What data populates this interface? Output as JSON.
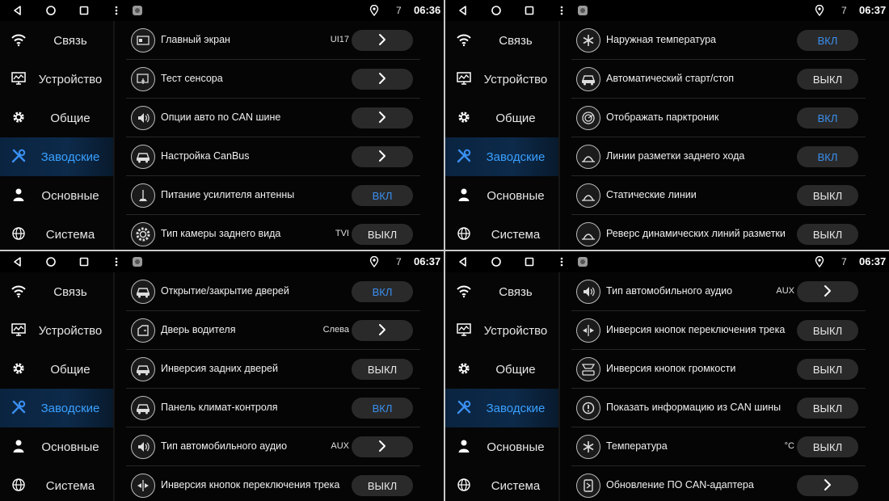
{
  "colors": {
    "accent": "#3a8ff0",
    "active_nav_bg": "#0d2a4a",
    "toggle_bg": "#2a2a2a",
    "background": "#050505"
  },
  "screens": [
    {
      "status": {
        "count": "7",
        "time": "06:36"
      },
      "nav": [
        {
          "label": "Связь",
          "icon": "wifi-icon"
        },
        {
          "label": "Устройство",
          "icon": "monitor-icon"
        },
        {
          "label": "Общие",
          "icon": "gear-icon"
        },
        {
          "label": "Заводские",
          "icon": "tools-icon"
        },
        {
          "label": "Основные",
          "icon": "user-icon"
        },
        {
          "label": "Система",
          "icon": "globe-icon"
        }
      ],
      "active_nav": 3,
      "rows": [
        {
          "label": "Главный экран",
          "extra": "UI17",
          "control": "arrow",
          "icon": "main-screen-icon"
        },
        {
          "label": "Тест сенсора",
          "extra": "",
          "control": "arrow",
          "icon": "touch-icon"
        },
        {
          "label": "Опции авто по CAN шине",
          "extra": "",
          "control": "arrow",
          "icon": "speaker-icon"
        },
        {
          "label": "Настройка CanBus",
          "extra": "",
          "control": "arrow",
          "icon": "car-icon"
        },
        {
          "label": "Питание усилителя антенны",
          "extra": "",
          "control": "ВКЛ",
          "state": "on",
          "icon": "antenna-icon"
        },
        {
          "label": "Тип камеры заднего вида",
          "extra": "TVI",
          "control": "ВЫКЛ",
          "state": "off",
          "icon": "camera-gear-icon"
        }
      ]
    },
    {
      "status": {
        "count": "7",
        "time": "06:37"
      },
      "nav": [
        {
          "label": "Связь",
          "icon": "wifi-icon"
        },
        {
          "label": "Устройство",
          "icon": "monitor-icon"
        },
        {
          "label": "Общие",
          "icon": "gear-icon"
        },
        {
          "label": "Заводские",
          "icon": "tools-icon"
        },
        {
          "label": "Основные",
          "icon": "user-icon"
        },
        {
          "label": "Система",
          "icon": "globe-icon"
        }
      ],
      "active_nav": 3,
      "rows": [
        {
          "label": "Наружная температура",
          "extra": "",
          "control": "ВКЛ",
          "state": "on",
          "icon": "snowflake-icon"
        },
        {
          "label": "Автоматический старт/стоп",
          "extra": "",
          "control": "ВЫКЛ",
          "state": "off",
          "icon": "car-icon"
        },
        {
          "label": "Отображать парктроник",
          "extra": "",
          "control": "ВКЛ",
          "state": "on",
          "icon": "radar-icon"
        },
        {
          "label": "Линии разметки заднего хода",
          "extra": "",
          "control": "ВКЛ",
          "state": "on",
          "icon": "lane-lines-icon"
        },
        {
          "label": "Статические линии",
          "extra": "",
          "control": "ВЫКЛ",
          "state": "off",
          "icon": "lane-lines-icon"
        },
        {
          "label": "Реверс динамических линий разметки",
          "extra": "",
          "control": "ВЫКЛ",
          "state": "off",
          "icon": "lane-lines-icon"
        }
      ]
    },
    {
      "status": {
        "count": "7",
        "time": "06:37"
      },
      "nav": [
        {
          "label": "Связь",
          "icon": "wifi-icon"
        },
        {
          "label": "Устройство",
          "icon": "monitor-icon"
        },
        {
          "label": "Общие",
          "icon": "gear-icon"
        },
        {
          "label": "Заводские",
          "icon": "tools-icon"
        },
        {
          "label": "Основные",
          "icon": "user-icon"
        },
        {
          "label": "Система",
          "icon": "globe-icon"
        }
      ],
      "active_nav": 3,
      "rows": [
        {
          "label": "Открытие/закрытие дверей",
          "extra": "",
          "control": "ВКЛ",
          "state": "on",
          "icon": "car-icon"
        },
        {
          "label": "Дверь водителя",
          "extra": "Слева",
          "control": "arrow",
          "icon": "car-door-icon"
        },
        {
          "label": "Инверсия задних дверей",
          "extra": "",
          "control": "ВЫКЛ",
          "state": "off",
          "icon": "car-icon"
        },
        {
          "label": "Панель климат-контроля",
          "extra": "",
          "control": "ВКЛ",
          "state": "on",
          "icon": "car-icon"
        },
        {
          "label": "Тип автомобильного аудио",
          "extra": "AUX",
          "control": "arrow",
          "icon": "speaker-icon"
        },
        {
          "label": "Инверсия кнопок переключения трека",
          "extra": "",
          "control": "ВЫКЛ",
          "state": "off",
          "icon": "track-switch-icon"
        }
      ]
    },
    {
      "status": {
        "count": "7",
        "time": "06:37"
      },
      "nav": [
        {
          "label": "Связь",
          "icon": "wifi-icon"
        },
        {
          "label": "Устройство",
          "icon": "monitor-icon"
        },
        {
          "label": "Общие",
          "icon": "gear-icon"
        },
        {
          "label": "Заводские",
          "icon": "tools-icon"
        },
        {
          "label": "Основные",
          "icon": "user-icon"
        },
        {
          "label": "Система",
          "icon": "globe-icon"
        }
      ],
      "active_nav": 3,
      "rows": [
        {
          "label": "Тип автомобильного аудио",
          "extra": "AUX",
          "control": "arrow",
          "icon": "speaker-icon"
        },
        {
          "label": "Инверсия кнопок переключения трека",
          "extra": "",
          "control": "ВЫКЛ",
          "state": "off",
          "icon": "track-switch-icon"
        },
        {
          "label": "Инверсия кнопок громкости",
          "extra": "",
          "control": "ВЫКЛ",
          "state": "off",
          "icon": "volume-keys-icon"
        },
        {
          "label": "Показать информацию из CAN шины",
          "extra": "",
          "control": "ВЫКЛ",
          "state": "off",
          "icon": "info-icon"
        },
        {
          "label": "Температура",
          "extra": "°C",
          "control": "ВЫКЛ",
          "state": "off",
          "icon": "snowflake-icon"
        },
        {
          "label": "Обновление ПО CAN-адаптера",
          "extra": "",
          "control": "arrow",
          "icon": "update-icon"
        }
      ]
    }
  ]
}
